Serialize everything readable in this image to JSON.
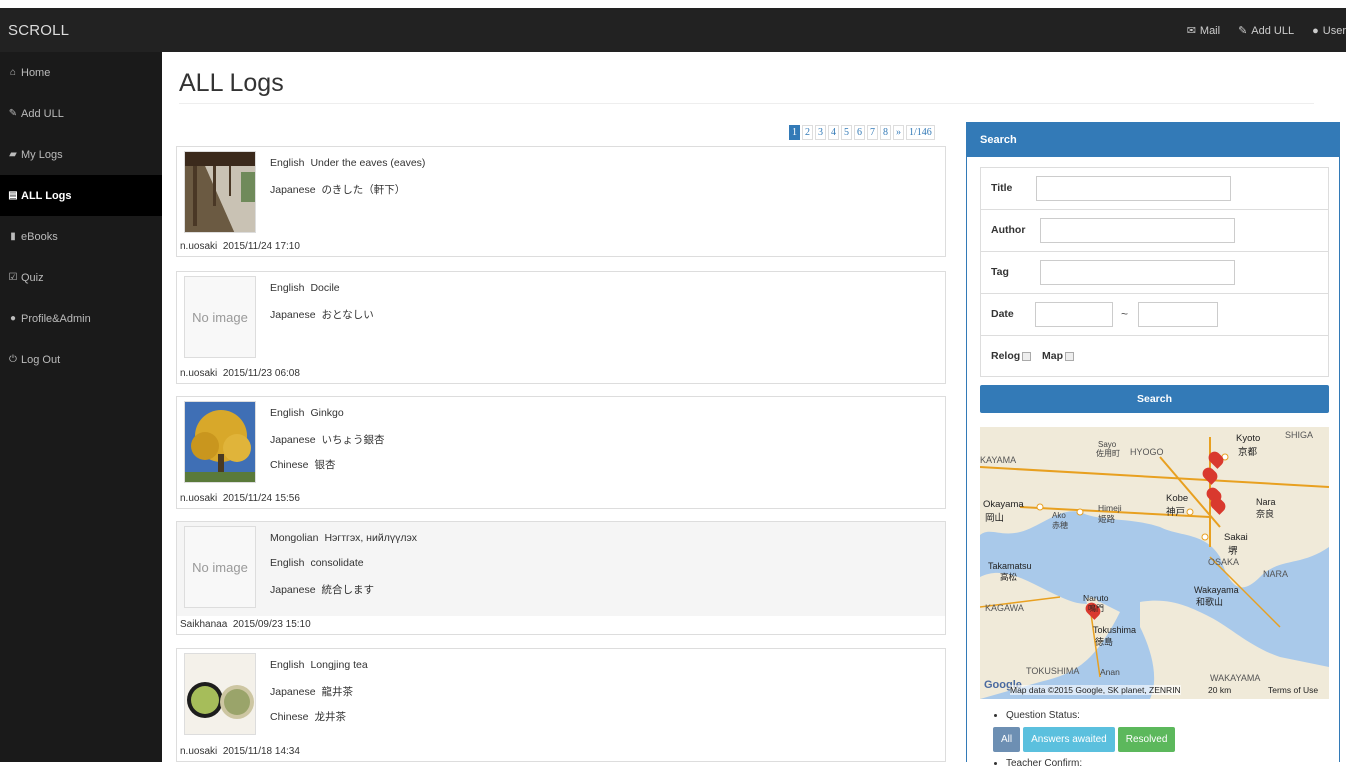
{
  "app": {
    "brand": "SCROLL"
  },
  "topnav": {
    "mail": "Mail",
    "add": "Add  ULL",
    "user": "User"
  },
  "sidebar": {
    "items": [
      {
        "label": "Home",
        "icon": "home-icon"
      },
      {
        "label": "Add  ULL",
        "icon": "pencil-icon"
      },
      {
        "label": "My Logs",
        "icon": "folder-icon"
      },
      {
        "label": "ALL Logs",
        "icon": "list-icon",
        "active": true
      },
      {
        "label": "eBooks",
        "icon": "book-icon"
      },
      {
        "label": "Quiz",
        "icon": "checkbox-icon"
      },
      {
        "label": "Profile&Admin",
        "icon": "user-icon"
      },
      {
        "label": "Log Out",
        "icon": "power-icon"
      }
    ]
  },
  "page": {
    "title": "ALL Logs"
  },
  "pager": {
    "pages": [
      "1",
      "2",
      "3",
      "4",
      "5",
      "6",
      "7",
      "8"
    ],
    "next": "»",
    "total": "1/146",
    "current": "1"
  },
  "logs": [
    {
      "image": "photo",
      "lines": [
        {
          "lang": "English",
          "text": "Under the eaves (eaves)"
        },
        {
          "lang": "Japanese",
          "text": "のきした（軒下）"
        }
      ],
      "author": "n.uosaki",
      "date": "2015/11/24 17:10"
    },
    {
      "image": "none",
      "lines": [
        {
          "lang": "English",
          "text": "Docile"
        },
        {
          "lang": "Japanese",
          "text": "おとなしい"
        }
      ],
      "author": "n.uosaki",
      "date": "2015/11/23 06:08"
    },
    {
      "image": "photo",
      "lines": [
        {
          "lang": "English",
          "text": "Ginkgo"
        },
        {
          "lang": "Japanese",
          "text": "いちょう銀杏"
        },
        {
          "lang": "Chinese",
          "text": "银杏"
        }
      ],
      "author": "n.uosaki",
      "date": "2015/11/24 15:56"
    },
    {
      "image": "none",
      "lines": [
        {
          "lang": "Mongolian",
          "text": "Нэгтгэх, нийлүүлэх"
        },
        {
          "lang": "English",
          "text": "consolidate"
        },
        {
          "lang": "Japanese",
          "text": "統合します"
        }
      ],
      "author": "Saikhanaa",
      "date": "2015/09/23 15:10"
    },
    {
      "image": "photo",
      "lines": [
        {
          "lang": "English",
          "text": "Longjing tea"
        },
        {
          "lang": "Japanese",
          "text": "龍井茶"
        },
        {
          "lang": "Chinese",
          "text": "龙井茶"
        }
      ],
      "author": "n.uosaki",
      "date": "2015/11/18 14:34"
    }
  ],
  "noimage_label": "No image",
  "search": {
    "header": "Search",
    "title_label": "Title",
    "author_label": "Author",
    "tag_label": "Tag",
    "date_label": "Date",
    "date_separator": "~",
    "relog_label": "Relog",
    "map_label": "Map",
    "button": "Search"
  },
  "map": {
    "labels": [
      "Kyoto",
      "京都",
      "SHIGA",
      "HYOGO",
      "Sayo",
      "佐用町",
      "KAYAMA",
      "Okayama",
      "岡山",
      "Ako",
      "赤穂",
      "Himeji",
      "姫路",
      "Kobe",
      "神戸",
      "Nara",
      "奈良",
      "Sakai",
      "堺",
      "OSAKA",
      "NARA",
      "Takamatsu",
      "高松",
      "Wakayama",
      "和歌山",
      "Naruto",
      "鳴門",
      "KAGAWA",
      "Tokushima",
      "徳島",
      "TOKUSHIMA",
      "Anan",
      "WAKAYAMA"
    ],
    "attribution": "Map data ©2015 Google, SK planet, ZENRIN",
    "scale": "20 km",
    "terms": "Terms of Use",
    "google": "Google"
  },
  "status": {
    "question_label": "Question Status:",
    "buttons": [
      "All",
      "Answers awaited",
      "Resolved"
    ],
    "teacher_label": "Teacher Confirm:"
  },
  "colors": {
    "primary": "#337ab7",
    "topbar": "#222222",
    "sidebar": "#1a1a1a",
    "success": "#5cb85c",
    "info": "#5bc0de"
  }
}
